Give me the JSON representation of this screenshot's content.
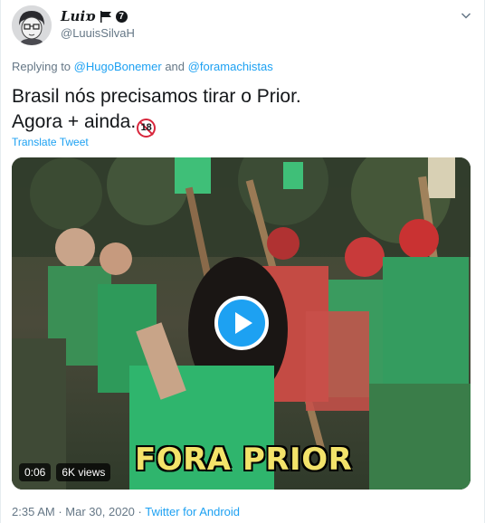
{
  "author": {
    "display_name": "Luiɒ",
    "badge": "7",
    "handle": "@LuuisSilvaH"
  },
  "reply": {
    "prefix": "Replying to",
    "user1": "@HugoBonemer",
    "connector": "and",
    "user2": "@foramachistas"
  },
  "tweet": {
    "line1": "Brasil nós precisamos tirar o Prior.",
    "line2": "Agora + ainda.",
    "emoji_label": "18",
    "translate_label": "Translate Tweet"
  },
  "video": {
    "caption": "FORA PRIOR",
    "duration": "0:06",
    "views": "6K views"
  },
  "meta": {
    "time": "2:35 AM",
    "sep1": "·",
    "date": "Mar 30, 2020",
    "sep2": "·",
    "source": "Twitter for Android"
  },
  "colors": {
    "link": "#1da1f2",
    "muted": "#657786",
    "text": "#14171a"
  }
}
